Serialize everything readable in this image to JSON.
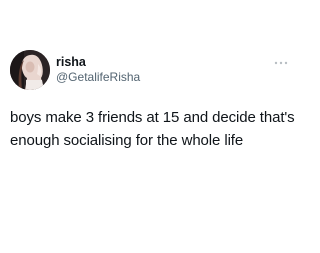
{
  "tweet": {
    "author": {
      "display_name": "risha",
      "handle": "@GetalifeRisha",
      "avatar_icon": "profile-photo"
    },
    "menu_icon": "more-horizontal-icon",
    "text": "boys make 3 friends at 15 and decide that's enough socialising for the whole life"
  },
  "colors": {
    "background": "#ffffff",
    "text_primary": "#0f1419",
    "text_secondary": "#536471",
    "menu_dots": "#b8bec3"
  }
}
